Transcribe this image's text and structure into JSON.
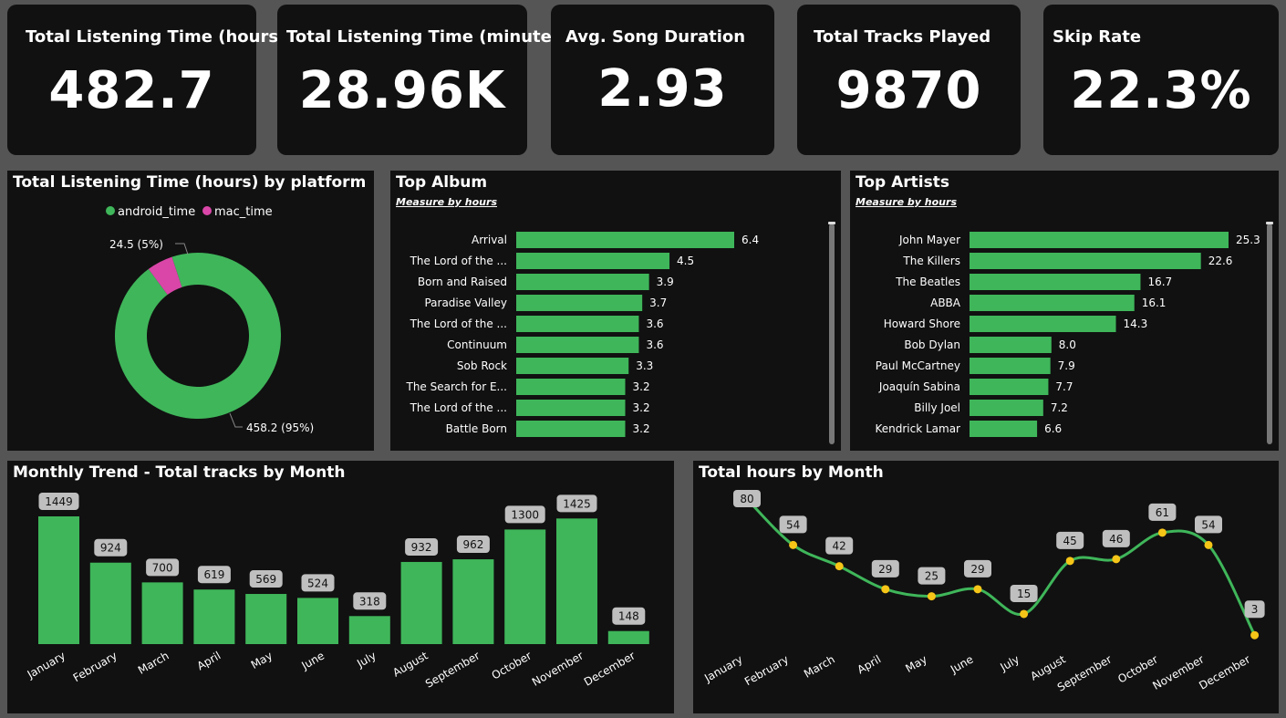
{
  "kpis": [
    {
      "title": "Total Listening Time (hours)",
      "value": "482.7"
    },
    {
      "title": "Total Listening Time (minutes)",
      "value": "28.96K"
    },
    {
      "title": "Avg. Song Duration",
      "value": "2.93"
    },
    {
      "title": "Total Tracks Played",
      "value": "9870"
    },
    {
      "title": "Skip Rate",
      "value": "22.3%"
    }
  ],
  "colors": {
    "green": "#3fb65a",
    "pink": "#d946a8",
    "yellow": "#f5c518",
    "panel": "#111111",
    "background": "#555555"
  },
  "chart_data": [
    {
      "type": "pie",
      "variant": "donut",
      "title": "Total Listening Time (hours) by platform",
      "legend_position": "top-center",
      "series": [
        {
          "name": "android_time",
          "value": 458.2,
          "label": "458.2 (95%)",
          "color": "#3fb65a"
        },
        {
          "name": "mac_time",
          "value": 24.5,
          "label": "24.5 (5%)",
          "color": "#d946a8"
        }
      ]
    },
    {
      "type": "bar",
      "orientation": "horizontal",
      "title": "Top Album",
      "subtitle": "Measure by hours",
      "categories": [
        "Arrival",
        "The Lord of the ...",
        "Born and Raised",
        "Paradise Valley",
        "The Lord of the ...",
        "Continuum",
        "Sob Rock",
        "The Search for E...",
        "The Lord of the ...",
        "Battle Born"
      ],
      "values": [
        6.4,
        4.5,
        3.9,
        3.7,
        3.6,
        3.6,
        3.3,
        3.2,
        3.2,
        3.2
      ],
      "labels": [
        "6.4",
        "4.5",
        "3.9",
        "3.7",
        "3.6",
        "3.6",
        "3.3",
        "3.2",
        "3.2",
        "3.2"
      ],
      "xlim": [
        0,
        6.4
      ]
    },
    {
      "type": "bar",
      "orientation": "horizontal",
      "title": "Top Artists",
      "subtitle": "Measure by hours",
      "categories": [
        "John Mayer",
        "The Killers",
        "The Beatles",
        "ABBA",
        "Howard Shore",
        "Bob Dylan",
        "Paul McCartney",
        "Joaquín Sabina",
        "Billy Joel",
        "Kendrick Lamar"
      ],
      "values": [
        25.3,
        22.6,
        16.7,
        16.1,
        14.3,
        8.0,
        7.9,
        7.7,
        7.2,
        6.6
      ],
      "labels": [
        "25.3",
        "22.6",
        "16.7",
        "16.1",
        "14.3",
        "8.0",
        "7.9",
        "7.7",
        "7.2",
        "6.6"
      ],
      "xlim": [
        0,
        25.3
      ]
    },
    {
      "type": "bar",
      "title": "Monthly Trend - Total tracks by Month",
      "categories": [
        "January",
        "February",
        "March",
        "April",
        "May",
        "June",
        "July",
        "August",
        "September",
        "October",
        "November",
        "December"
      ],
      "values": [
        1449,
        924,
        700,
        619,
        569,
        524,
        318,
        932,
        962,
        1300,
        1425,
        148
      ],
      "labels": [
        "1449",
        "924",
        "700",
        "619",
        "569",
        "524",
        "318",
        "932",
        "962",
        "1300",
        "1425",
        "148"
      ],
      "ylim": [
        0,
        1449
      ]
    },
    {
      "type": "line",
      "title": "Total hours by Month",
      "categories": [
        "January",
        "February",
        "March",
        "April",
        "May",
        "June",
        "July",
        "August",
        "September",
        "October",
        "November",
        "December"
      ],
      "values": [
        80,
        54,
        42,
        29,
        25,
        29,
        15,
        45,
        46,
        61,
        54,
        3
      ],
      "labels": [
        "80",
        "54",
        "42",
        "29",
        "25",
        "29",
        "15",
        "45",
        "46",
        "61",
        "54",
        "3"
      ],
      "ylim": [
        0,
        80
      ]
    }
  ]
}
